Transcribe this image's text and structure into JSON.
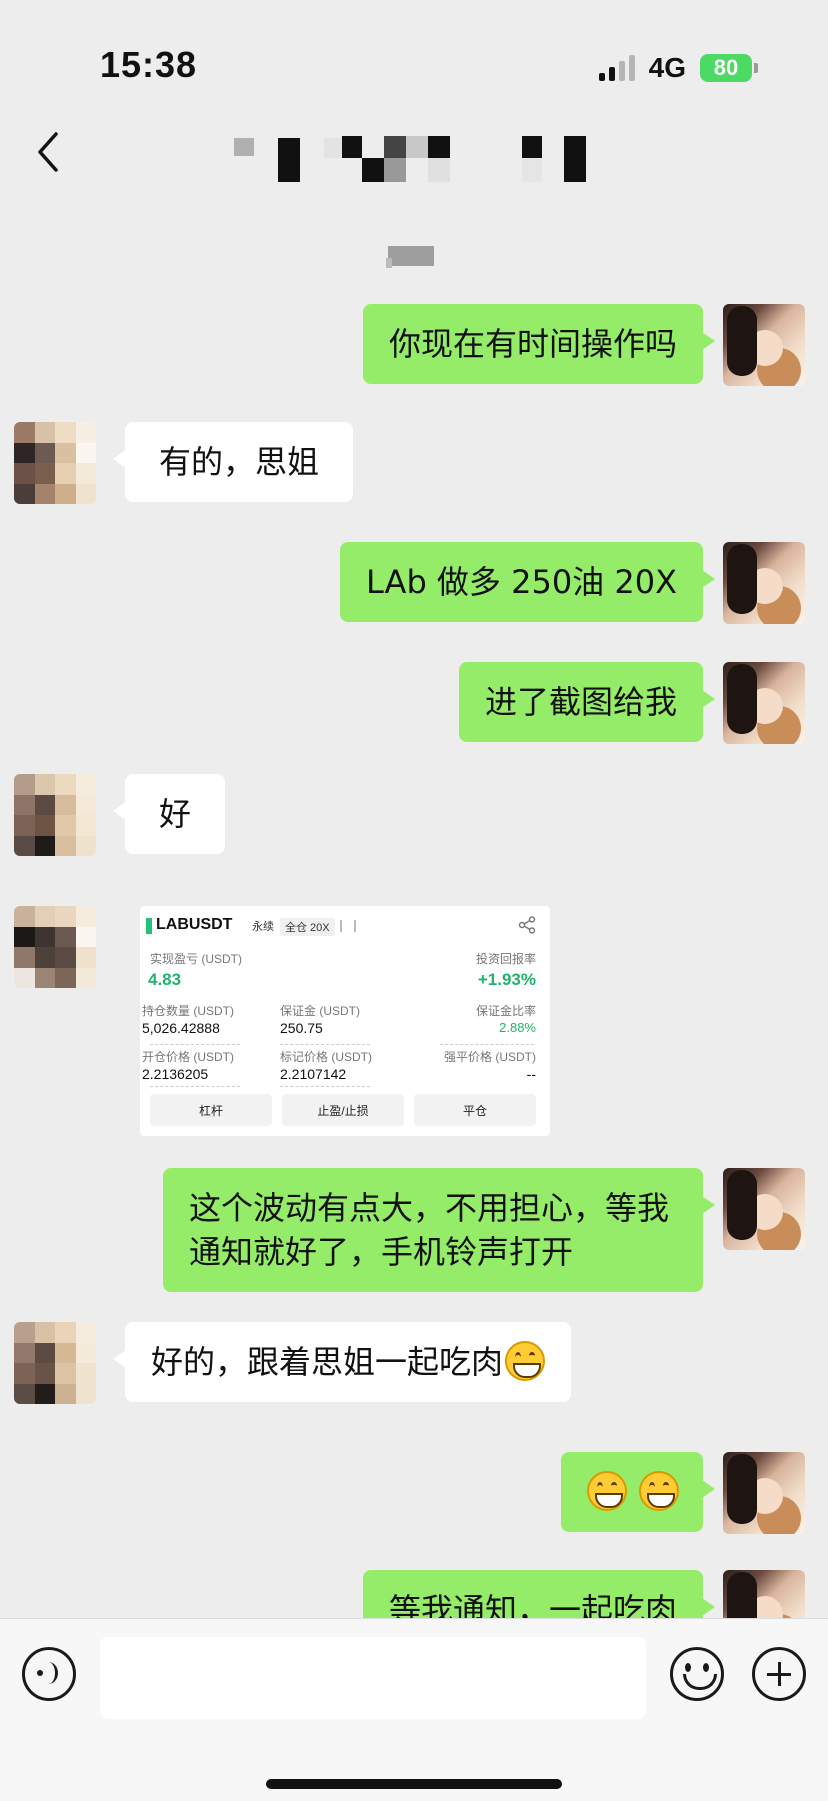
{
  "status": {
    "time": "15:38",
    "network": "4G",
    "battery": "80"
  },
  "messages": [
    {
      "side": "self",
      "text": "你现在有时间操作吗"
    },
    {
      "side": "other",
      "text": "有的，思姐"
    },
    {
      "side": "self",
      "text": "LAb 做多 250油 20X"
    },
    {
      "side": "self",
      "text": "进了截图给我"
    },
    {
      "side": "other",
      "text": "好"
    },
    {
      "side": "other",
      "type": "image"
    },
    {
      "side": "self",
      "text": "这个波动有点大，不用担心，等我通知就好了，手机铃声打开"
    },
    {
      "side": "other",
      "text": "好的，跟着思姐一起吃肉"
    },
    {
      "side": "self",
      "type": "emoji"
    },
    {
      "side": "self",
      "text": "等我通知，一起吃肉"
    }
  ],
  "trade_card": {
    "symbol": "LABUSDT",
    "tag_perp": "永续",
    "tag_cross": "全仓 20X",
    "realized_pnl_label": "实现盈亏 (USDT)",
    "realized_pnl_value": "4.83",
    "roi_label": "投资回报率",
    "roi_value": "+1.93%",
    "qty_label": "持仓数量 (USDT)",
    "qty_value": "5,026.42888",
    "margin_label": "保证金 (USDT)",
    "margin_value": "250.75",
    "margin_ratio_label": "保证金比率",
    "margin_ratio_value": "2.88%",
    "open_price_label": "开仓价格 (USDT)",
    "open_price_value": "2.2136205",
    "mark_price_label": "标记价格 (USDT)",
    "mark_price_value": "2.2107142",
    "liq_price_label": "强平价格 (USDT)",
    "liq_price_value": "--",
    "btn_leverage": "杠杆",
    "btn_tpsl": "止盈/止损",
    "btn_close": "平仓"
  },
  "colors": {
    "self_bubble": "#95ec69",
    "other_bubble": "#ffffff",
    "background": "#ededed",
    "profit_green": "#23b26d"
  }
}
